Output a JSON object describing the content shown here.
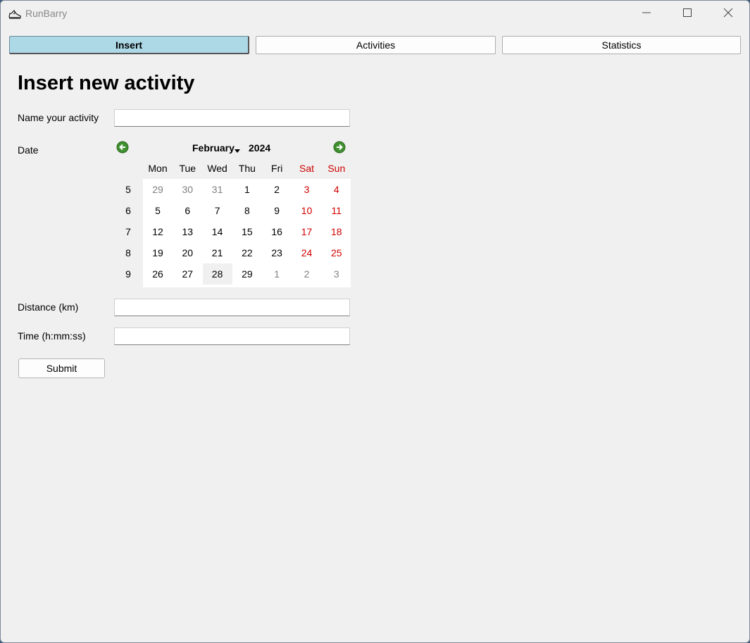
{
  "window": {
    "title": "RunBarry",
    "app_icon": "running-shoe-icon"
  },
  "tabs": [
    {
      "label": "Insert",
      "active": true
    },
    {
      "label": "Activities",
      "active": false
    },
    {
      "label": "Statistics",
      "active": false
    }
  ],
  "form": {
    "title": "Insert new activity",
    "name_label": "Name your activity",
    "name_value": "",
    "date_label": "Date",
    "distance_label": "Distance (km)",
    "distance_value": "",
    "time_label": "Time (h:mm:ss)",
    "time_value": "",
    "submit_label": "Submit"
  },
  "calendar": {
    "month": "February",
    "year": "2024",
    "weekdays": [
      "Mon",
      "Tue",
      "Wed",
      "Thu",
      "Fri",
      "Sat",
      "Sun"
    ],
    "weeks": [
      {
        "num": "5",
        "days": [
          "29",
          "30",
          "31",
          "1",
          "2",
          "3",
          "4"
        ]
      },
      {
        "num": "6",
        "days": [
          "5",
          "6",
          "7",
          "8",
          "9",
          "10",
          "11"
        ]
      },
      {
        "num": "7",
        "days": [
          "12",
          "13",
          "14",
          "15",
          "16",
          "17",
          "18"
        ]
      },
      {
        "num": "8",
        "days": [
          "19",
          "20",
          "21",
          "22",
          "23",
          "24",
          "25"
        ]
      },
      {
        "num": "9",
        "days": [
          "26",
          "27",
          "28",
          "29",
          "1",
          "2",
          "3"
        ]
      }
    ],
    "selected_day": "28",
    "colors": {
      "weekend": "#d00000",
      "other_month": "#808080",
      "active_tab": "#add8e6"
    }
  }
}
